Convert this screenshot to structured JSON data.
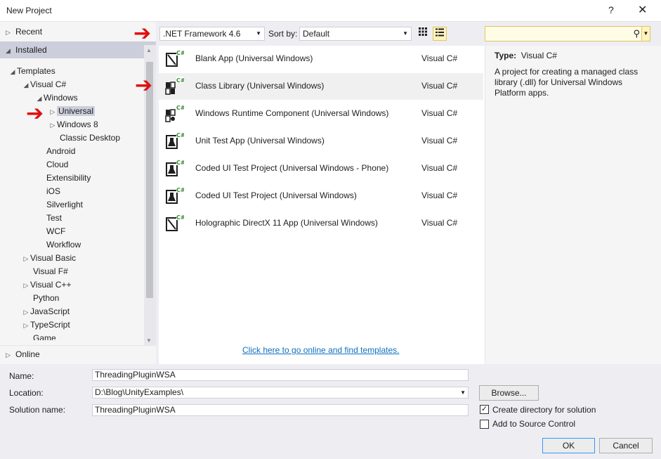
{
  "window": {
    "title": "New Project",
    "help_glyph": "?",
    "close_glyph": "✕"
  },
  "tree": {
    "recent": "Recent",
    "installed": "Installed",
    "online": "Online",
    "templates": "Templates",
    "visual_csharp": "Visual C#",
    "windows": "Windows",
    "universal": "Universal",
    "windows8": "Windows 8",
    "classic_desktop": "Classic Desktop",
    "items": [
      "Android",
      "Cloud",
      "Extensibility",
      "iOS",
      "Silverlight",
      "Test",
      "WCF",
      "Workflow"
    ],
    "visual_basic": "Visual Basic",
    "visual_fsharp": "Visual F#",
    "visual_cpp": "Visual C++",
    "python": "Python",
    "javascript": "JavaScript",
    "typescript": "TypeScript",
    "game": "Game"
  },
  "toolbar": {
    "framework": ".NET Framework 4.6",
    "sort_label": "Sort by:",
    "sort_value": "Default",
    "search_placeholder": ""
  },
  "templates": [
    {
      "name": "Blank App (Universal Windows)",
      "lang": "Visual C#",
      "icon": "blank-app-icon",
      "selected": false
    },
    {
      "name": "Class Library (Universal Windows)",
      "lang": "Visual C#",
      "icon": "class-library-icon",
      "selected": true
    },
    {
      "name": "Windows Runtime Component (Universal Windows)",
      "lang": "Visual C#",
      "icon": "runtime-component-icon",
      "selected": false
    },
    {
      "name": "Unit Test App (Universal Windows)",
      "lang": "Visual C#",
      "icon": "test-flask-icon",
      "selected": false
    },
    {
      "name": "Coded UI Test Project (Universal Windows - Phone)",
      "lang": "Visual C#",
      "icon": "test-flask-icon",
      "selected": false
    },
    {
      "name": "Coded UI Test Project (Universal Windows)",
      "lang": "Visual C#",
      "icon": "test-flask-icon",
      "selected": false
    },
    {
      "name": "Holographic DirectX 11 App (Universal Windows)",
      "lang": "Visual C#",
      "icon": "blank-app-icon",
      "selected": false
    }
  ],
  "online_link": "Click here to go online and find templates.",
  "description": {
    "type_label": "Type:",
    "type_value": "Visual C#",
    "text": "A project for creating a managed class library (.dll) for Universal Windows Platform apps."
  },
  "form": {
    "name_label": "Name:",
    "name_value": "ThreadingPluginWSA",
    "location_label": "Location:",
    "location_value": "D:\\Blog\\UnityExamples\\",
    "solution_label": "Solution name:",
    "solution_value": "ThreadingPluginWSA",
    "browse": "Browse...",
    "create_dir_label": "Create directory for solution",
    "create_dir_checked": true,
    "source_control_label": "Add to Source Control",
    "source_control_checked": false,
    "ok": "OK",
    "cancel": "Cancel"
  },
  "colors": {
    "annotation_arrow": "#e01010",
    "link": "#0e70c0",
    "selection": "#cccedb",
    "csharp_badge": "#388a34"
  }
}
